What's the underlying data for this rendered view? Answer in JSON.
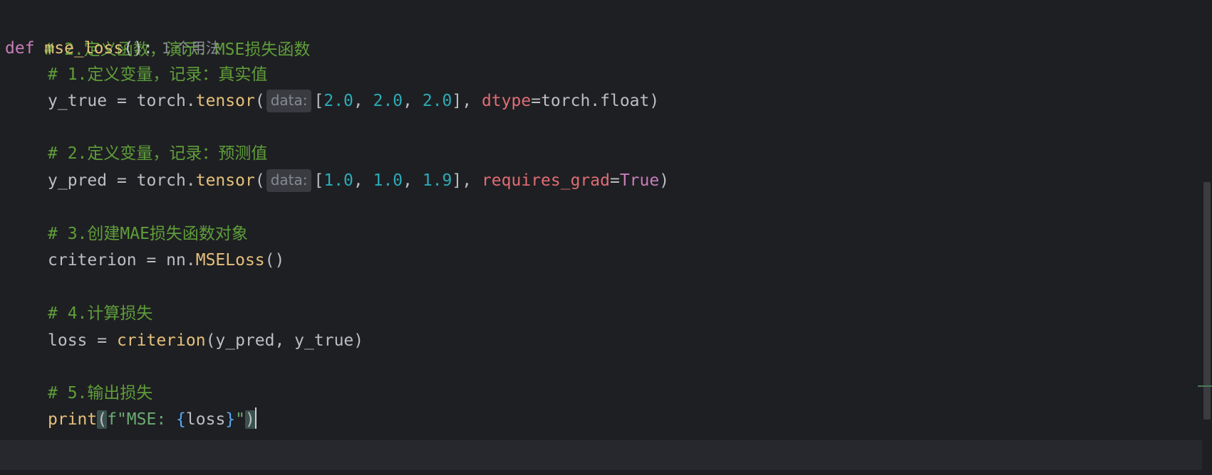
{
  "editor": {
    "lines": [
      {
        "comment": "# 2.定义函数，演示：MSE损失函数"
      },
      {
        "def_kw": "def",
        "fn_name": "mse_loss",
        "sig": "():",
        "usage_hint": "1 个用法"
      },
      {
        "comment": "# 1.定义变量，记录：真实值"
      },
      {
        "var": "y_true",
        "eq": " = ",
        "obj": "torch.",
        "call": "tensor",
        "open": "(",
        "hint": "data:",
        "args": [
          "2.0",
          "2.0",
          "2.0"
        ],
        "kwarg": "dtype",
        "kwval": "torch.float",
        "close": ")"
      },
      {
        "comment": "# 2.定义变量，记录：预测值"
      },
      {
        "var": "y_pred",
        "eq": " = ",
        "obj": "torch.",
        "call": "tensor",
        "open": "(",
        "hint": "data:",
        "args": [
          "1.0",
          "1.0",
          "1.9"
        ],
        "kwarg": "requires_grad",
        "kwval": "True",
        "close": ")"
      },
      {
        "comment": "# 3.创建MAE损失函数对象"
      },
      {
        "var": "criterion",
        "eq": " = ",
        "obj": "nn.",
        "call": "MSELoss",
        "tail": "()"
      },
      {
        "comment": "# 4.计算损失"
      },
      {
        "var": "loss",
        "eq": " = ",
        "call": "criterion",
        "tail": "(y_pred, y_true)"
      },
      {
        "comment": "# 5.输出损失"
      },
      {
        "call": "print",
        "open": "(",
        "fprefix": "f\"MSE: ",
        "brace_open": "{",
        "inner": "loss",
        "brace_close": "}",
        "quote": "\"",
        "close": ")"
      }
    ]
  },
  "colors": {
    "background": "#1e1f22",
    "comment": "#5f9e3a",
    "keyword": "#cf8e6d",
    "number": "#2aacb8",
    "call": "#e5c07b"
  }
}
